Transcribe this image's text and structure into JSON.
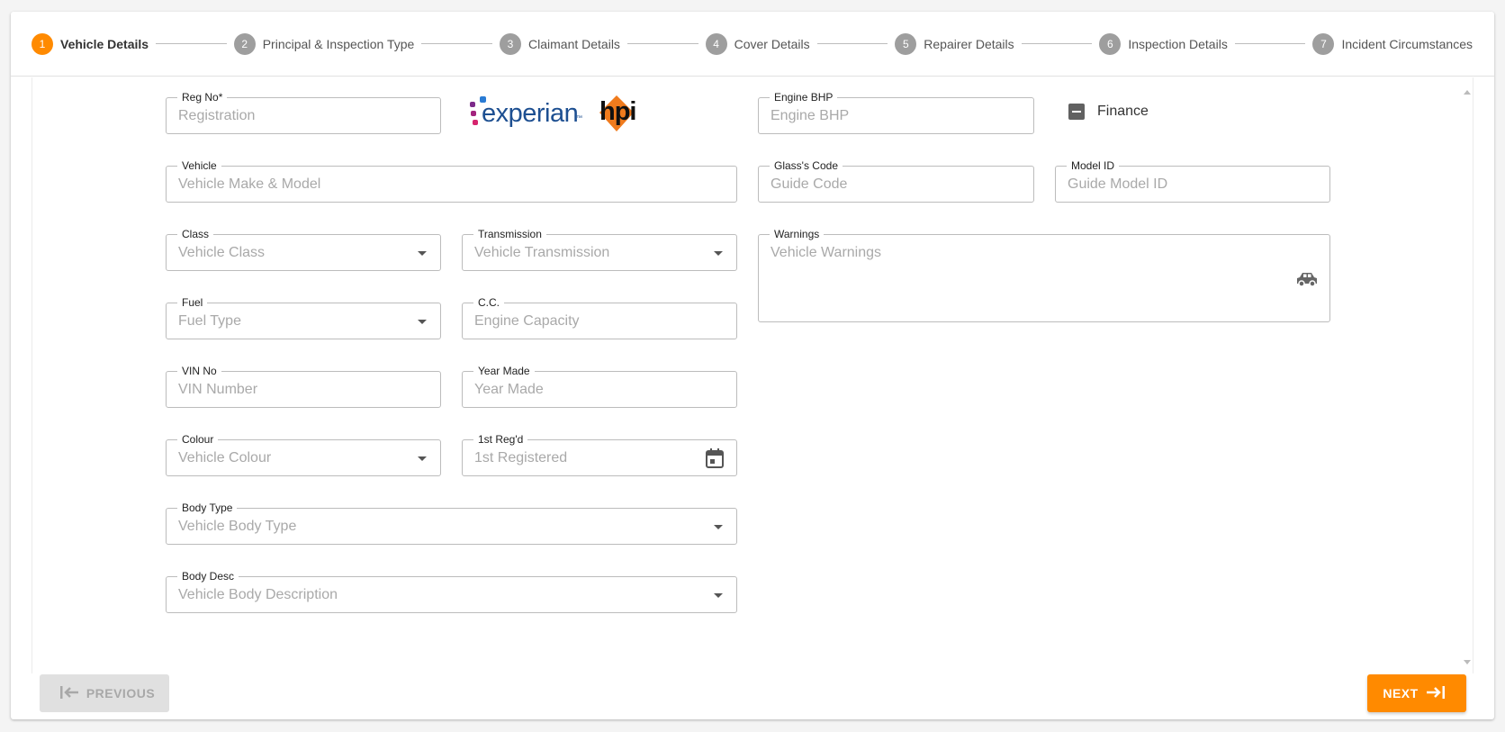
{
  "stepper": {
    "steps": [
      {
        "num": "1",
        "label": "Vehicle Details",
        "active": true
      },
      {
        "num": "2",
        "label": "Principal & Inspection Type"
      },
      {
        "num": "3",
        "label": "Claimant Details"
      },
      {
        "num": "4",
        "label": "Cover Details"
      },
      {
        "num": "5",
        "label": "Repairer Details"
      },
      {
        "num": "6",
        "label": "Inspection Details"
      },
      {
        "num": "7",
        "label": "Incident Circumstances"
      }
    ]
  },
  "form": {
    "reg_no": {
      "label": "Reg No*",
      "placeholder": "Registration"
    },
    "vehicle": {
      "label": "Vehicle",
      "placeholder": "Vehicle Make & Model"
    },
    "class": {
      "label": "Class",
      "placeholder": "Vehicle Class"
    },
    "transmission": {
      "label": "Transmission",
      "placeholder": "Vehicle Transmission"
    },
    "fuel": {
      "label": "Fuel",
      "placeholder": "Fuel Type"
    },
    "cc": {
      "label": "C.C.",
      "placeholder": "Engine Capacity"
    },
    "vin": {
      "label": "VIN No",
      "placeholder": "VIN Number"
    },
    "year_made": {
      "label": "Year Made",
      "placeholder": "Year Made"
    },
    "colour": {
      "label": "Colour",
      "placeholder": "Vehicle Colour"
    },
    "first_regd": {
      "label": "1st Reg'd",
      "placeholder": "1st Registered"
    },
    "body_type": {
      "label": "Body Type",
      "placeholder": "Vehicle Body Type"
    },
    "body_desc": {
      "label": "Body Desc",
      "placeholder": "Vehicle Body Description"
    },
    "engine_bhp": {
      "label": "Engine BHP",
      "placeholder": "Engine BHP"
    },
    "finance": {
      "label": "Finance"
    },
    "glass_code": {
      "label": "Glass's Code",
      "placeholder": "Guide Code"
    },
    "model_id": {
      "label": "Model ID",
      "placeholder": "Guide Model ID"
    },
    "warnings": {
      "label": "Warnings",
      "placeholder": "Vehicle Warnings"
    }
  },
  "brands": {
    "experian": "experian",
    "experian_tm": "™",
    "hpi": "hpi"
  },
  "buttons": {
    "previous": "PREVIOUS",
    "next": "NEXT"
  },
  "colors": {
    "accent": "#ff8a00",
    "step_inactive": "#9e9e9e"
  }
}
